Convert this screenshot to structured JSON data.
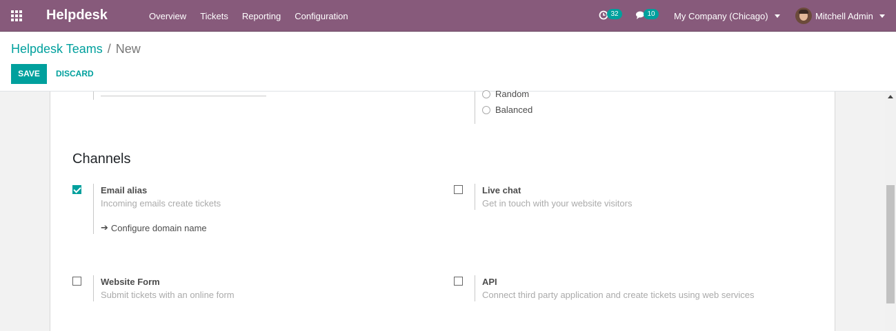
{
  "navbar": {
    "brand": "Helpdesk",
    "menu": [
      "Overview",
      "Tickets",
      "Reporting",
      "Configuration"
    ],
    "activity_count": "32",
    "message_count": "10",
    "company": "My Company (Chicago)",
    "user": "Mitchell Admin",
    "color": "#875a7b",
    "badge_color": "#00a09d"
  },
  "breadcrumb": {
    "parent": "Helpdesk Teams",
    "separator": "/",
    "current": "New"
  },
  "buttons": {
    "save": "SAVE",
    "discard": "DISCARD"
  },
  "assignment": {
    "options": [
      "Random",
      "Balanced"
    ]
  },
  "channels": {
    "title": "Channels",
    "items": [
      {
        "title": "Email alias",
        "description": "Incoming emails create tickets",
        "checked": true,
        "link": "Configure domain name"
      },
      {
        "title": "Live chat",
        "description": "Get in touch with your website visitors",
        "checked": false
      },
      {
        "title": "Website Form",
        "description": "Submit tickets with an online form",
        "checked": false
      },
      {
        "title": "API",
        "description": "Connect third party application and create tickets using web services",
        "checked": false
      }
    ]
  }
}
